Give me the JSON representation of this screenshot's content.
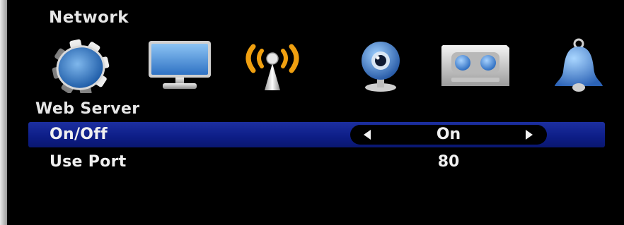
{
  "screen": {
    "title": "Network"
  },
  "tabs": [
    {
      "icon": "gear-icon"
    },
    {
      "icon": "monitor-icon"
    },
    {
      "icon": "wireless-antenna-icon",
      "active": true
    },
    {
      "icon": "webcam-icon"
    },
    {
      "icon": "cassette-recorder-icon"
    },
    {
      "icon": "bell-icon"
    }
  ],
  "section": {
    "title": "Web Server"
  },
  "settings": [
    {
      "label": "On/Off",
      "value": "On"
    },
    {
      "label": "Use Port",
      "value": "80"
    }
  ],
  "colors": {
    "background": "#000000",
    "selection": "#0d1d86",
    "text": "#f0f0f0",
    "active_icon": "#f0a010"
  }
}
